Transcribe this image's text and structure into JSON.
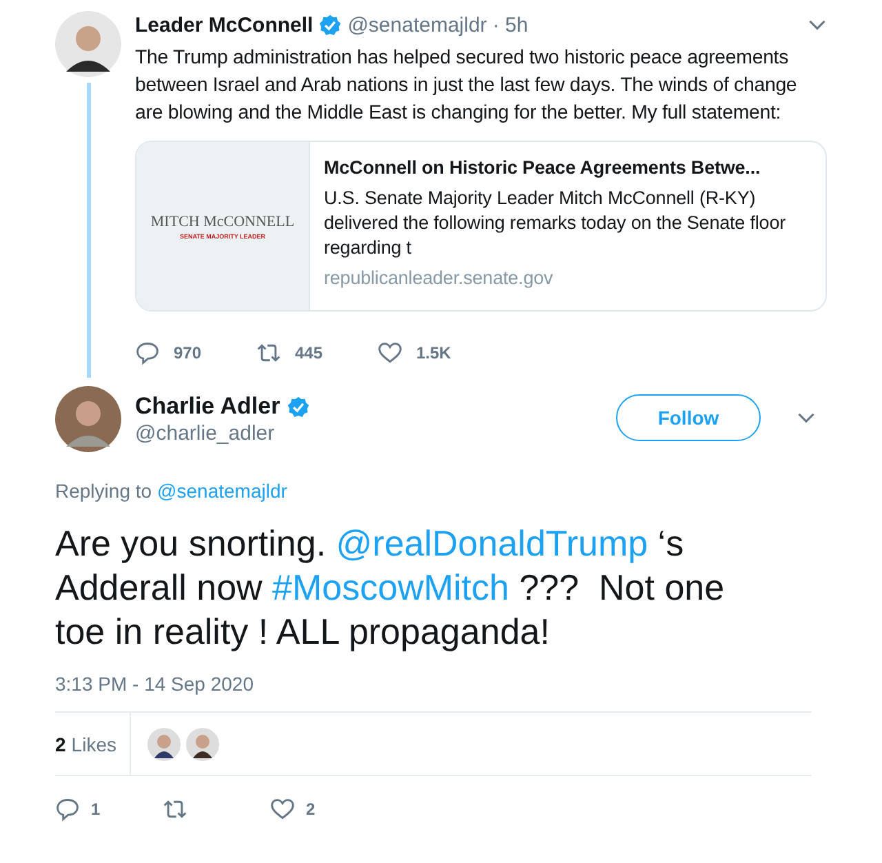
{
  "quoted_tweet": {
    "name": "Leader McConnell",
    "verified": true,
    "handle": "@senatemajldr",
    "time": "· 5h",
    "text": "The Trump administration has helped secured two historic peace agreements between Israel and Arab nations in just the last few days. The winds of change are blowing and the Middle East is changing for the better. My full statement:",
    "card": {
      "image_title": "MITCH McCONNELL",
      "image_subtitle": "SENATE MAJORITY LEADER",
      "title": "McConnell on Historic Peace Agreements Betwe...",
      "description": "U.S. Senate Majority Leader Mitch McConnell (R-KY) delivered the following remarks today on the Senate floor regarding t",
      "domain": "republicanleader.senate.gov"
    },
    "actions": [
      {
        "kind": "reply",
        "count": "970"
      },
      {
        "kind": "retweet",
        "count": "445"
      },
      {
        "kind": "like",
        "count": "1.5K"
      }
    ]
  },
  "tweet": {
    "name": "Charlie Adler",
    "verified": true,
    "handle": "@charlie_adler",
    "follow_button": "Follow",
    "replying_label": "Replying to",
    "replying_to": "@senatemajldr",
    "segments": [
      {
        "kind": "text",
        "text": "Are you snorting. "
      },
      {
        "kind": "link",
        "text": "@realDonaldTrump"
      },
      {
        "kind": "text",
        "text": " ‘s Adderall now "
      },
      {
        "kind": "link",
        "text": "#MoscowMitch"
      },
      {
        "kind": "text",
        "text": " ???  Not one toe in reality ! ALL propaganda!"
      }
    ],
    "timestamp": "3:13 PM - 14 Sep 2020",
    "likes_count": "2",
    "likes_label": "Likes",
    "likers": [
      {
        "color": "#2b3a67"
      },
      {
        "color": "#3a2a22"
      }
    ],
    "actions": [
      {
        "kind": "reply",
        "count": "1"
      },
      {
        "kind": "retweet"
      },
      {
        "kind": "like",
        "count": "2"
      }
    ]
  }
}
